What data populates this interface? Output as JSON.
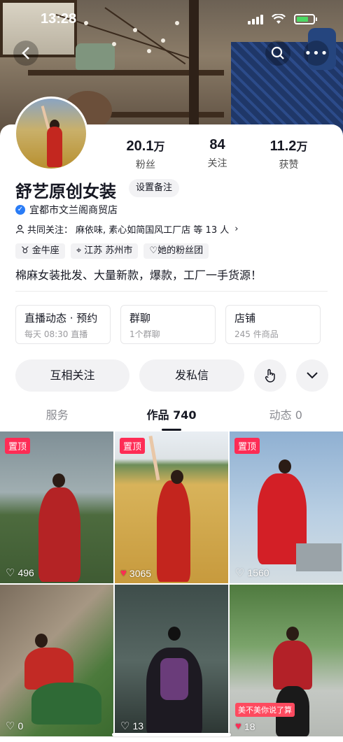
{
  "status": {
    "time": "13:28"
  },
  "profile": {
    "name": "舒艺原创女装",
    "remark_button": "设置备注",
    "verified_text": "宜都市文兰阁商贸店",
    "mutual_prefix": "共同关注：",
    "mutual_text": "麻依味, 素心如简国风工厂店 等 13 人",
    "tags": [
      "金牛座",
      "江苏 苏州市",
      "她的粉丝团"
    ],
    "bio": "棉麻女装批发、大量新款，爆款，工厂一手货源！"
  },
  "stats": [
    {
      "num": "20.1",
      "unit": "万",
      "label": "粉丝"
    },
    {
      "num": "84",
      "unit": "",
      "label": "关注"
    },
    {
      "num": "11.2",
      "unit": "万",
      "label": "获赞"
    }
  ],
  "info_cards": [
    {
      "title": "直播动态 · 预约",
      "sub": "每天 08:30 直播"
    },
    {
      "title": "群聊",
      "sub": "1个群聊"
    },
    {
      "title": "店铺",
      "sub": "245 件商品"
    }
  ],
  "actions": {
    "follow": "互相关注",
    "message": "发私信"
  },
  "tabs": [
    {
      "label": "服务",
      "active": false
    },
    {
      "label": "作品 740",
      "active": true
    },
    {
      "label": "动态 0",
      "active": false
    }
  ],
  "grid": [
    {
      "pinned": "置顶",
      "likes": "496",
      "liked": false
    },
    {
      "pinned": "置顶",
      "likes": "3065",
      "liked": true
    },
    {
      "pinned": "置顶",
      "likes": "1560",
      "liked": false
    },
    {
      "pinned": "",
      "likes": "0",
      "liked": false
    },
    {
      "pinned": "",
      "likes": "13",
      "liked": false
    },
    {
      "pinned": "",
      "likes": "18",
      "liked": true,
      "overlay": "美不美你说了算"
    }
  ],
  "colors": {
    "accent": "#fe2c55",
    "verify": "#2a7cf6"
  }
}
